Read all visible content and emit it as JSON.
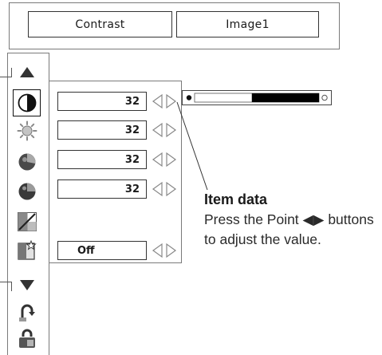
{
  "header": {
    "menu_label": "Contrast",
    "image_mode": "Image1"
  },
  "sidebar": {
    "icons": [
      {
        "name": "scroll-up-arrow-icon"
      },
      {
        "name": "contrast-icon",
        "selected": true
      },
      {
        "name": "brightness-icon"
      },
      {
        "name": "color-icon"
      },
      {
        "name": "tint-icon"
      },
      {
        "name": "color-temperature-icon"
      },
      {
        "name": "sharpness-icon"
      },
      {
        "name": "scroll-down-arrow-icon"
      },
      {
        "name": "reset-icon"
      },
      {
        "name": "store-icon"
      }
    ]
  },
  "items": [
    {
      "value": "32"
    },
    {
      "value": "32"
    },
    {
      "value": "32"
    },
    {
      "value": "32"
    },
    {
      "value": "Off"
    }
  ],
  "slider": {
    "position": 0.46
  },
  "annotation": {
    "title": "Item data",
    "description": "Press the Point ◀▶ buttons to adjust the value."
  },
  "colors": {
    "slider_fill": "#000000",
    "selection_border": "#111111"
  }
}
